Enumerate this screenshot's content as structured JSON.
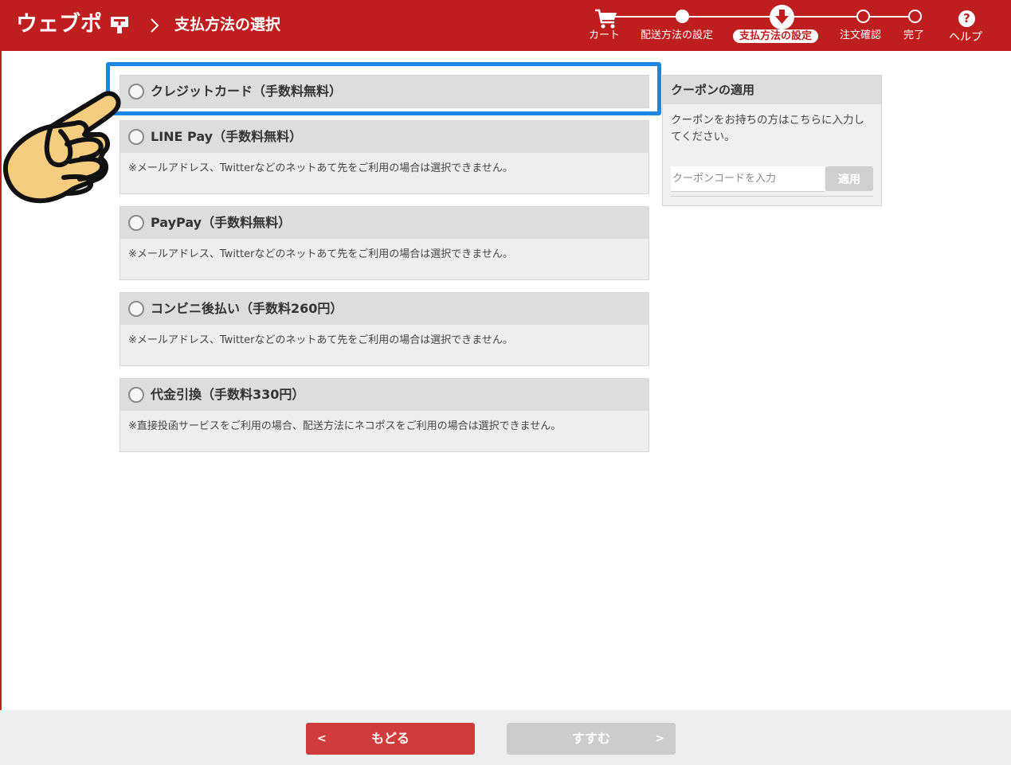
{
  "header": {
    "logo_text": "ウェブポ",
    "page_title": "支払方法の選択",
    "steps": [
      {
        "label": "カート",
        "state": "done"
      },
      {
        "label": "配送方法の設定",
        "state": "done"
      },
      {
        "label": "支払方法の設定",
        "state": "current"
      },
      {
        "label": "注文確認",
        "state": "todo"
      },
      {
        "label": "完了",
        "state": "todo"
      }
    ],
    "help_label": "ヘルプ",
    "help_icon_glyph": "?"
  },
  "payment_options": [
    {
      "title": "クレジットカード（手数料無料）",
      "note": "",
      "selected": false,
      "highlighted": true
    },
    {
      "title": "LINE Pay（手数料無料）",
      "note": "※メールアドレス、Twitterなどのネットあて先をご利用の場合は選択できません。",
      "selected": false
    },
    {
      "title": "PayPay（手数料無料）",
      "note": "※メールアドレス、Twitterなどのネットあて先をご利用の場合は選択できません。",
      "selected": false
    },
    {
      "title": "コンビニ後払い（手数料260円）",
      "note": "※メールアドレス、Twitterなどのネットあて先をご利用の場合は選択できません。",
      "selected": false
    },
    {
      "title": "代金引換（手数料330円）",
      "note": "※直接投函サービスをご利用の場合、配送方法にネコポスをご利用の場合は選択できません。",
      "selected": false
    }
  ],
  "coupon": {
    "title": "クーポンの適用",
    "description": "クーポンをお持ちの方はこちらに入力してください。",
    "input_placeholder": "クーポンコードを入力",
    "input_value": "",
    "apply_label": "適用"
  },
  "footer": {
    "back_label": "もどる",
    "next_label": "すすむ",
    "back_chevron": "<",
    "next_chevron": ">"
  },
  "colors": {
    "brand_red": "#be1e1e",
    "highlight_blue": "#1a86e6",
    "back_button": "#cf3c3c",
    "disabled_button": "#cccccc"
  },
  "icons": {
    "cart": "cart-icon",
    "help": "help-icon",
    "radio": "radio-unchecked-icon",
    "pointer": "pointing-hand-icon"
  }
}
